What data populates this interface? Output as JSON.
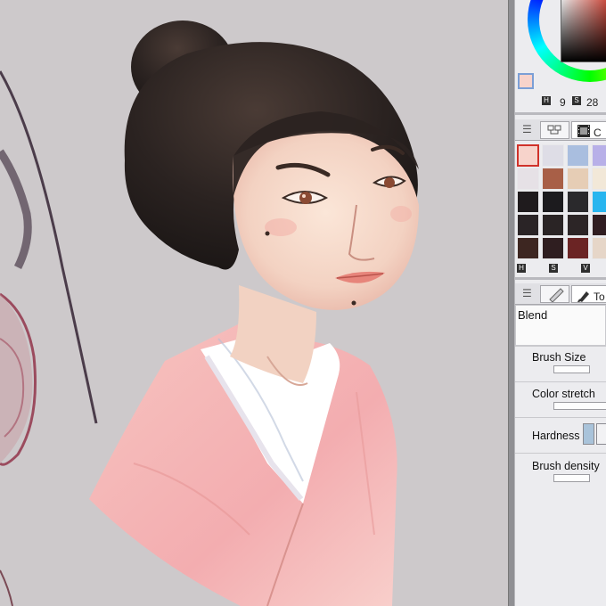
{
  "color_panel": {
    "main_color": "#f7d3cb",
    "sub_color": "#ffffff",
    "hsv_values": {
      "first": "9",
      "second_badge": "S",
      "third": "28"
    },
    "badge_h": "H"
  },
  "swatch_panel": {
    "tab_peek_label": "C",
    "swatches": [
      "#f7d3cb",
      "#dedde6",
      "#a9bedf",
      "#b8b0e8",
      "#e6e1e6",
      "#a85f47",
      "#e6cdb5",
      "#f2e8d8",
      "#1f1b1d",
      "#1c1b1e",
      "#2a292c",
      "#28b5ef",
      "#2a2426",
      "#2a2425",
      "#2c2526",
      "#301d21",
      "#3d2621",
      "#2f1e20",
      "#6b2424",
      "#e6d6c8"
    ],
    "selected_index": 0,
    "bottom_labels": {
      "h": "H",
      "s": "S",
      "v": "V"
    }
  },
  "tool_panel": {
    "tab_peek_label": "To",
    "blend_label": "Blend",
    "params": {
      "brush_size": "Brush Size",
      "color_stretch": "Color stretch",
      "hardness": "Hardness",
      "brush_density": "Brush density"
    }
  },
  "icons": {
    "menu": "hamburger-menu-icon",
    "navigator": "navigator-icon",
    "film": "film-icon",
    "pen": "pen-icon",
    "brush": "brush-icon"
  },
  "colors": {
    "canvas_bg": "#cdc9cb",
    "panel_bg": "#ececef",
    "kimono_pink": "#f4b6b5",
    "hair": "#2a2322"
  }
}
